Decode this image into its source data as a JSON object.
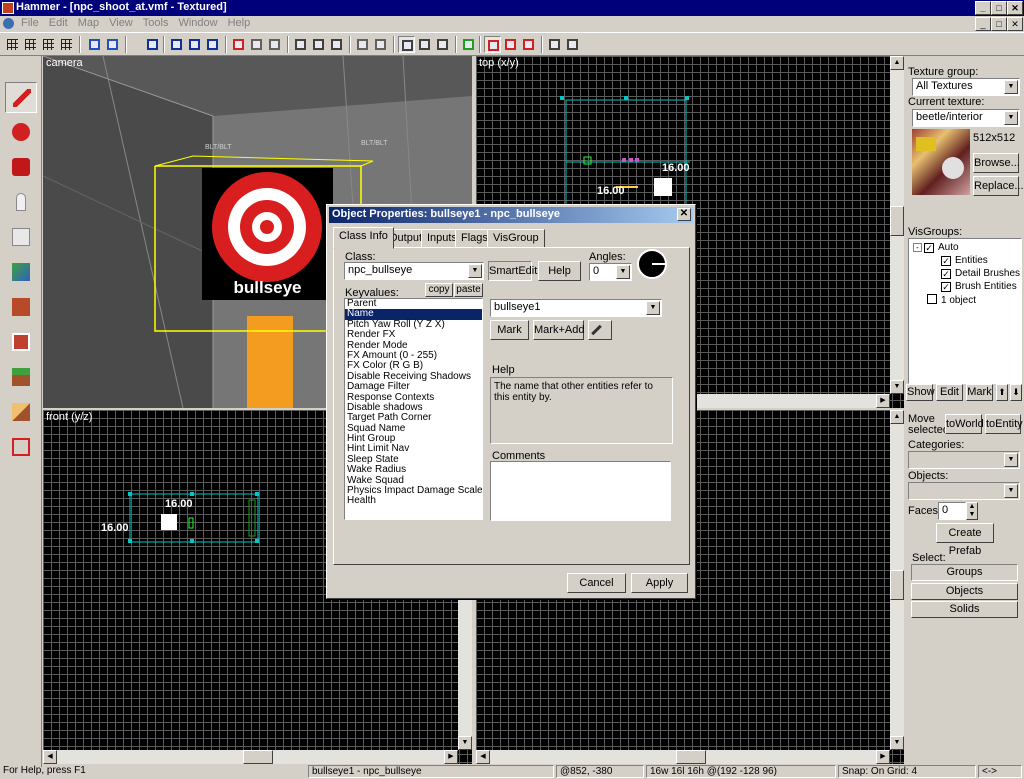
{
  "window": {
    "title": "Hammer - [npc_shoot_at.vmf - Textured]"
  },
  "menu": [
    "File",
    "Edit",
    "Map",
    "View",
    "Tools",
    "Window",
    "Help"
  ],
  "viewports": {
    "camera": "camera",
    "top": "top (x/y)",
    "front": "front (y/z)"
  },
  "dimensions": {
    "top_width": "16.00",
    "top_height": "16.00",
    "front_width": "16.00",
    "front_height": "16.00"
  },
  "camera": {
    "entity_label": "bullseye",
    "wall_tag_1": "BLT/BLT",
    "wall_tag_2": "BLT/BLT"
  },
  "dialog": {
    "title": "Object Properties: bullseye1 - npc_bullseye",
    "close_glyph": "✕",
    "tabs": [
      "Class Info",
      "Outputs",
      "Inputs",
      "Flags",
      "VisGroup"
    ],
    "class_label": "Class:",
    "class_value": "npc_bullseye",
    "smartedit_label": "SmartEdit",
    "help_button": "Help",
    "angles_label": "Angles:",
    "angles_value": "0",
    "keyvalues_label": "Keyvalues:",
    "copy_label": "copy",
    "paste_label": "paste",
    "keyvalues": [
      "Parent",
      "Name",
      "Pitch Yaw Roll (Y Z X)",
      "Render FX",
      "Render Mode",
      "FX Amount (0 - 255)",
      "FX Color (R G B)",
      "Disable Receiving Shadows",
      "Damage Filter",
      "Response Contexts",
      "Disable shadows",
      "Target Path Corner",
      "Squad Name",
      "Hint Group",
      "Hint Limit Nav",
      "Sleep State",
      "Wake Radius",
      "Wake Squad",
      "Physics Impact Damage Scale",
      "Health"
    ],
    "selected_key": "Name",
    "value_field": "bullseye1",
    "mark_label": "Mark",
    "markadd_label": "Mark+Add",
    "help_heading": "Help",
    "help_text": "The name that other entities refer to this entity by.",
    "comments_label": "Comments",
    "comments_text": "",
    "cancel_label": "Cancel",
    "apply_label": "Apply"
  },
  "right_panel": {
    "texture_group_label": "Texture group:",
    "texture_group_value": "All Textures",
    "current_texture_label": "Current texture:",
    "current_texture_value": "beetle/interior",
    "texture_size": "512x512",
    "browse_label": "Browse...",
    "replace_label": "Replace...",
    "visgroups_label": "VisGroups:",
    "visgroups": [
      {
        "label": "Auto",
        "checked": true
      },
      {
        "label": "Entities",
        "checked": true
      },
      {
        "label": "Detail Brushes",
        "checked": true
      },
      {
        "label": "Brush Entities",
        "checked": true
      },
      {
        "label": "1 object",
        "checked": false
      }
    ],
    "show_label": "Show",
    "edit_label": "Edit",
    "mark_label": "Mark",
    "up_glyph": "⬆",
    "down_glyph": "⬇",
    "move_selected_label": "Move selected:",
    "toworld_label": "toWorld",
    "toentity_label": "toEntity",
    "categories_label": "Categories:",
    "objects_label": "Objects:",
    "faces_label": "Faces:",
    "faces_value": "0",
    "create_prefab_label": "Create Prefab",
    "select_label": "Select:",
    "groups_label": "Groups",
    "objects_button_label": "Objects",
    "solids_label": "Solids"
  },
  "statusbar": {
    "help": "For Help, press F1",
    "selection": "bullseye1 - npc_bullseye",
    "coords": "@852, -380",
    "size": "16w 16l 16h @(192 -128 96)",
    "snap": "Snap: On Grid: 4",
    "arrows": "<->"
  },
  "colors": {
    "title_bg": "#00007b",
    "dialog_title_start": "#0a246a",
    "selection": "#0a246a",
    "grid_line": "#5a5a5a",
    "selection_box": "#00c8c8",
    "camera_box": "#ffff00",
    "orange_pillar": "#f39c1f",
    "bullseye_red": "#d81e1e"
  }
}
